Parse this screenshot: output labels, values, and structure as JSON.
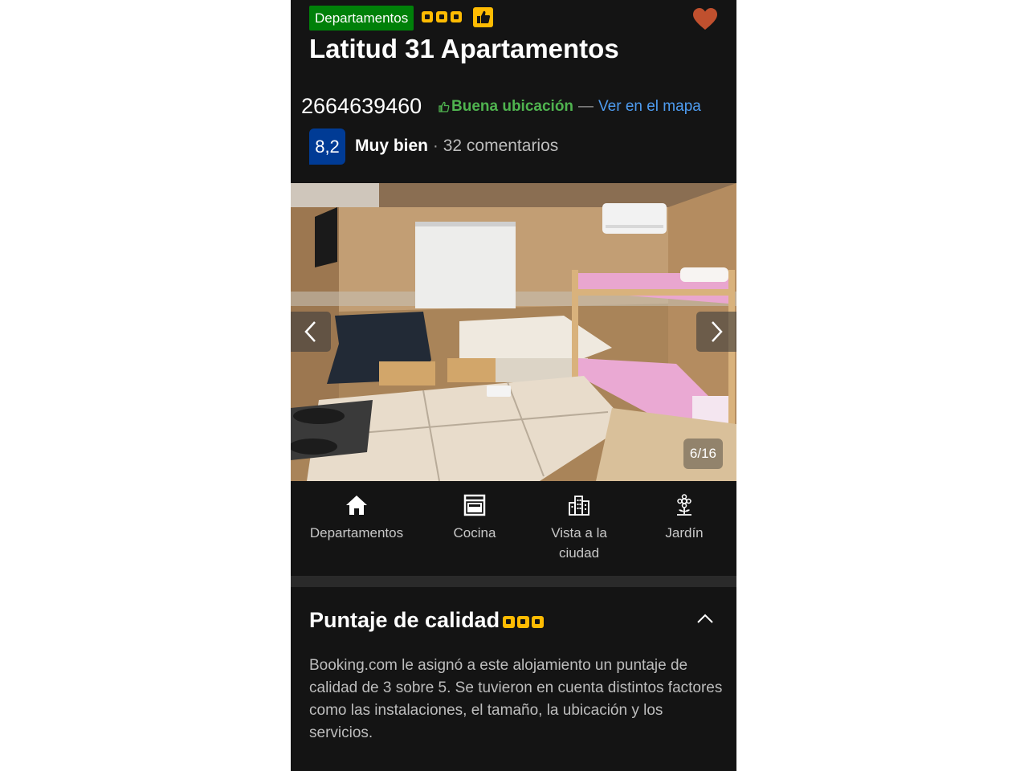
{
  "header": {
    "type_badge": "Departamentos",
    "stars": 3,
    "title": "Latitud 31 Apartamentos",
    "phone": "2664639460",
    "location_label": "Buena ubicación",
    "separator": "—",
    "map_link": "Ver en el mapa",
    "favorite_icon": "heart-icon"
  },
  "score": {
    "value": "8,2",
    "label": "Muy bien",
    "separator": "·",
    "reviews": "32 comentarios"
  },
  "gallery": {
    "counter": "6/16",
    "prev_icon": "chevron-left-icon",
    "next_icon": "chevron-right-icon"
  },
  "facilities": [
    {
      "label": "Departamentos",
      "icon": "home-icon"
    },
    {
      "label": "Cocina",
      "icon": "oven-icon"
    },
    {
      "label": "Vista a la ciudad",
      "icon": "city-icon"
    },
    {
      "label": "Jardín",
      "icon": "flower-icon"
    }
  ],
  "quality": {
    "title": "Puntaje de calidad",
    "stars": 3,
    "description": "Booking.com le asignó a este alojamiento un puntaje de calidad de 3 sobre 5. Se tuvieron en cuenta distintos factores como las instalaciones, el tamaño, la ubicación y los servicios.",
    "collapse_icon": "chevron-up-icon"
  },
  "colors": {
    "background": "#141414",
    "badge_green": "#008009",
    "star_yellow": "#febb02",
    "score_blue": "#003b95",
    "link_blue": "#4e9cf0",
    "location_green": "#4fb34f",
    "heart": "#c0502e"
  }
}
